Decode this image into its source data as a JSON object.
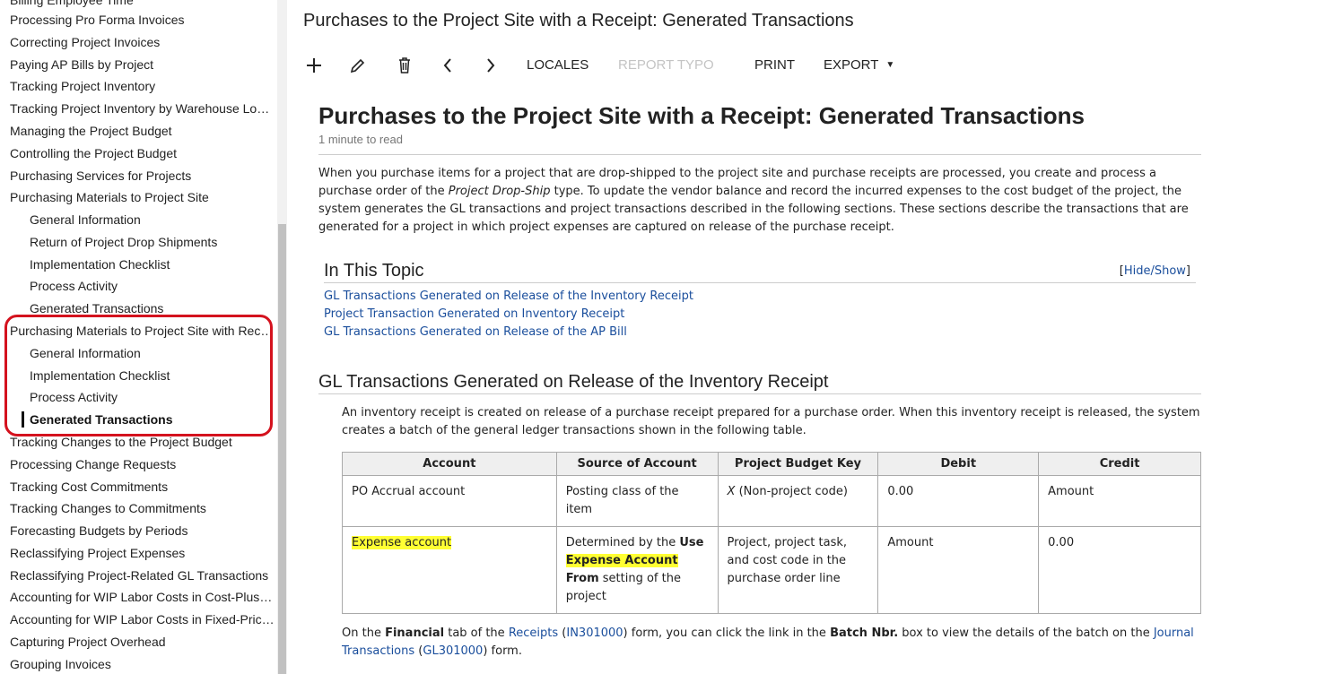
{
  "sidebar": {
    "items": [
      {
        "label": "Billing Employee Time"
      },
      {
        "label": "Processing Pro Forma Invoices"
      },
      {
        "label": "Correcting Project Invoices"
      },
      {
        "label": "Paying AP Bills by Project"
      },
      {
        "label": "Tracking Project Inventory"
      },
      {
        "label": "Tracking Project Inventory by Warehouse Location"
      },
      {
        "label": "Managing the Project Budget"
      },
      {
        "label": "Controlling the Project Budget"
      },
      {
        "label": "Purchasing Services for Projects"
      },
      {
        "label": "Purchasing Materials to Project Site"
      },
      {
        "label": "General Information"
      },
      {
        "label": "Return of Project Drop Shipments"
      },
      {
        "label": "Implementation Checklist"
      },
      {
        "label": "Process Activity"
      },
      {
        "label": "Generated Transactions"
      },
      {
        "label": "Purchasing Materials to Project Site with Receipt"
      },
      {
        "label": "General Information"
      },
      {
        "label": "Implementation Checklist"
      },
      {
        "label": "Process Activity"
      },
      {
        "label": "Generated Transactions"
      },
      {
        "label": "Tracking Changes to the Project Budget"
      },
      {
        "label": "Processing Change Requests"
      },
      {
        "label": "Tracking Cost Commitments"
      },
      {
        "label": "Tracking Changes to Commitments"
      },
      {
        "label": "Forecasting Budgets by Periods"
      },
      {
        "label": "Reclassifying Project Expenses"
      },
      {
        "label": "Reclassifying Project-Related GL Transactions"
      },
      {
        "label": "Accounting for WIP Labor Costs in Cost-Plus Projects"
      },
      {
        "label": "Accounting for WIP Labor Costs in Fixed-Price Projects"
      },
      {
        "label": "Capturing Project Overhead"
      },
      {
        "label": "Grouping Invoices"
      }
    ]
  },
  "header": {
    "title": "Purchases to the Project Site with a Receipt: Generated Transactions"
  },
  "toolbar": {
    "locales": "LOCALES",
    "report_typo": "REPORT TYPO",
    "print": "PRINT",
    "export": "EXPORT"
  },
  "article": {
    "title": "Purchases to the Project Site with a Receipt: Generated Transactions",
    "read_time": "1 minute to read",
    "intro_1": "When you purchase items for a project that are drop-shipped to the project site and purchase receipts are processed, you create and process a purchase order of the ",
    "intro_em": "Project Drop-Ship",
    "intro_2": " type. To update the vendor balance and record the incurred expenses to the cost budget of the project, the system generates the GL transactions and project transactions described in the following sections. These sections describe the transactions that are generated for a project in which project expenses are captured on release of the purchase receipt.",
    "in_topic": "In This Topic",
    "hide_show": "Hide/Show",
    "topic_links": [
      "GL Transactions Generated on Release of the Inventory Receipt",
      "Project Transaction Generated on Inventory Receipt",
      "GL Transactions Generated on Release of the AP Bill"
    ],
    "section_title": "GL Transactions Generated on Release of the Inventory Receipt",
    "section_text": "An inventory receipt is created on release of a purchase receipt prepared for a purchase order. When this inventory receipt is released, the system creates a batch of the general ledger transactions shown in the following table.",
    "table": {
      "headers": [
        "Account",
        "Source of Account",
        "Project Budget Key",
        "Debit",
        "Credit"
      ],
      "row1": {
        "account": "PO Accrual account",
        "source": "Posting class of the item",
        "key_x": "X",
        "key_rest": " (Non-project code)",
        "debit": "0.00",
        "credit": "Amount"
      },
      "row2": {
        "account": "Expense account",
        "source_1": "Determined by the ",
        "source_b1": "Use",
        "source_b2": "Expense Account",
        "source_b3": "From",
        "source_2": " setting of the project",
        "key": "Project, project task, and cost code in the purchase order line",
        "debit": "Amount",
        "credit": "0.00"
      }
    },
    "footer": {
      "t1": "On the ",
      "b1": "Financial",
      "t2": " tab of the ",
      "l1": "Receipts",
      "t3": " (",
      "l2": "IN301000",
      "t4": ") form, you can click the link in the ",
      "b2": "Batch Nbr.",
      "t5": " box to view the details of the batch on the ",
      "l3": "Journal Transactions",
      "t6": " (",
      "l4": "GL301000",
      "t7": ") form."
    }
  }
}
